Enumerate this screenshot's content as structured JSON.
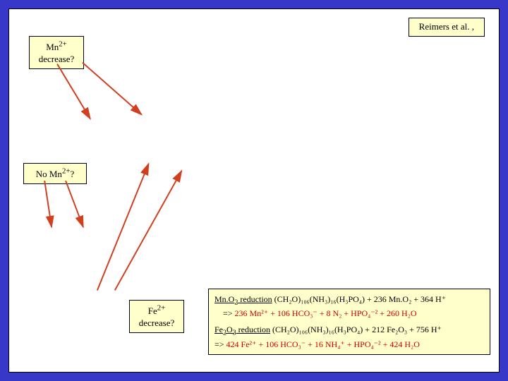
{
  "citation": "Reimers et al. ,",
  "boxes": {
    "mn_decrease": {
      "line1": "Mn",
      "sup1": "2+",
      "line2": "decrease?"
    },
    "no_mn": {
      "text_pre": "No Mn",
      "sup": "2+",
      "text_post": "?"
    },
    "fe_decrease": {
      "line1": "Fe",
      "sup1": "2+",
      "line2": "decrease?"
    }
  },
  "reactions": {
    "mno2": {
      "title_pre": "Mn.O",
      "title_sub": "2",
      "title_post": " reduction",
      "eq_lhs": " (CH₂O)₁₀₆(NH₃)₁₆(H₃PO₄) + 236 Mn.O₂ + 364 H⁺",
      "arrow": "=>",
      "eq_rhs": "  236 Mn²⁺ + 106 HCO₃⁻ + 8 N₂ + HPO₄⁻² + 260 H₂O"
    },
    "fe2o3": {
      "title_pre": "Fe",
      "title_sub": "2",
      "title_mid": "O",
      "title_sub2": "3",
      "title_post": " reduction",
      "eq_lhs": " (CH₂O)₁₀₆(NH₃)₁₆(H₃PO₄) + 212 Fe₂O₃ + 756 H⁺",
      "arrow": "=>",
      "eq_rhs": "   424 Fe²⁺ + 106 HCO₃⁻ + 16 NH₄⁺ + HPO₄⁻² + 424 H₂O"
    }
  }
}
